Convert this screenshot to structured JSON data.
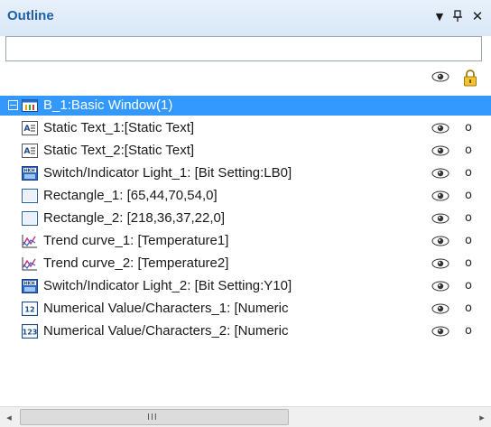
{
  "panel": {
    "title": "Outline",
    "controls": {
      "dropdown": "▼",
      "pin": "ᵖ",
      "close": "✕"
    },
    "search": {
      "value": "",
      "placeholder": ""
    }
  },
  "header": {
    "visible_icon": "eye-icon",
    "lock_icon": "lock-icon"
  },
  "tree": {
    "root": {
      "label": "B_1:Basic Window(1)",
      "icon": "window-icon",
      "expanded": true,
      "selected": true
    },
    "items": [
      {
        "label": "Static Text_1:[Static Text]",
        "icon": "static-text-icon"
      },
      {
        "label": "Static Text_2:[Static Text]",
        "icon": "static-text-icon"
      },
      {
        "label": "Switch/Indicator Light_1: [Bit Setting:LB0]",
        "icon": "switch-icon"
      },
      {
        "label": "Rectangle_1: [65,44,70,54,0]",
        "icon": "rectangle-icon"
      },
      {
        "label": "Rectangle_2: [218,36,37,22,0]",
        "icon": "rectangle-icon"
      },
      {
        "label": "Trend curve_1: [Temperature1]",
        "icon": "trend-icon"
      },
      {
        "label": "Trend curve_2: [Temperature2]",
        "icon": "trend-icon"
      },
      {
        "label": "Switch/Indicator Light_2: [Bit Setting:Y10]",
        "icon": "switch-icon"
      },
      {
        "label": "Numerical Value/Characters_1: [Numeric",
        "icon": "numeric-12-icon",
        "badge": "12"
      },
      {
        "label": "Numerical Value/Characters_2: [Numeric",
        "icon": "numeric-123-icon",
        "badge": "123"
      }
    ],
    "lock_mark": "o"
  },
  "scrollbar": {
    "left": "◂",
    "right": "▸",
    "grip": "III"
  }
}
